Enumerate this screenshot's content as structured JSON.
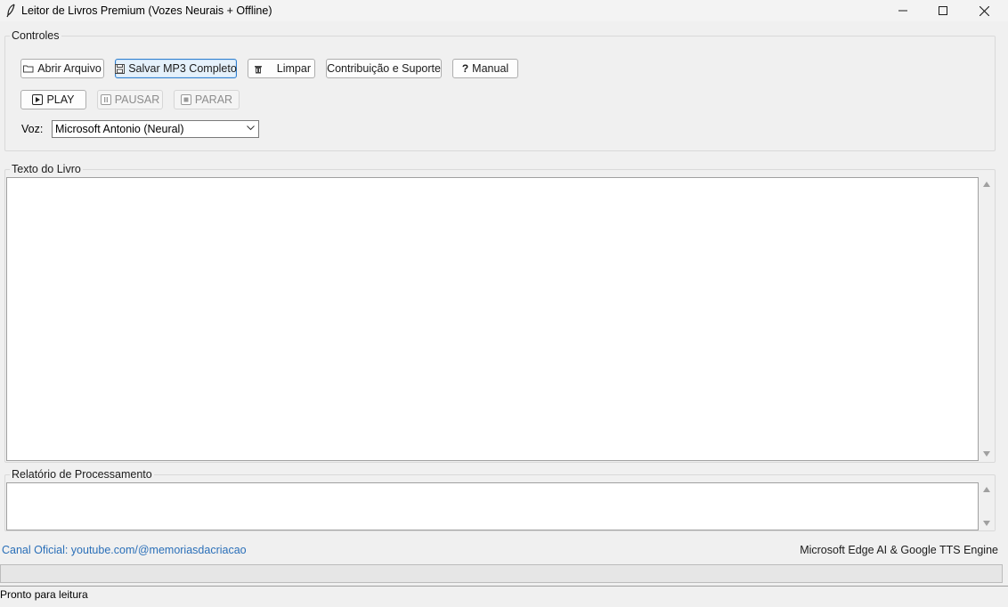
{
  "window": {
    "title": "Leitor de Livros Premium (Vozes Neurais + Offline)",
    "icon": "feather-icon"
  },
  "controls": {
    "group_label": "Controles",
    "buttons": {
      "open": "Abrir Arquivo",
      "save_mp3": "Salvar MP3 Completo",
      "clear": "Limpar",
      "support": "Contribuição e Suporte",
      "manual": "Manual",
      "play": "PLAY",
      "pause": "PAUSAR",
      "stop": "PARAR"
    },
    "voice_label": "Voz:",
    "voice_selected": "Microsoft Antonio (Neural)"
  },
  "book_text": {
    "group_label": "Texto do Livro",
    "content": ""
  },
  "report": {
    "group_label": "Relatório de Processamento",
    "content": ""
  },
  "footer": {
    "channel_link": "Canal Oficial: youtube.com/@memoriasdacriacao",
    "engine_text": "Microsoft Edge AI & Google TTS Engine"
  },
  "status": {
    "text": "Pronto para leitura"
  },
  "colors": {
    "link": "#2a6fb8",
    "focus_border": "#2f80d0"
  }
}
